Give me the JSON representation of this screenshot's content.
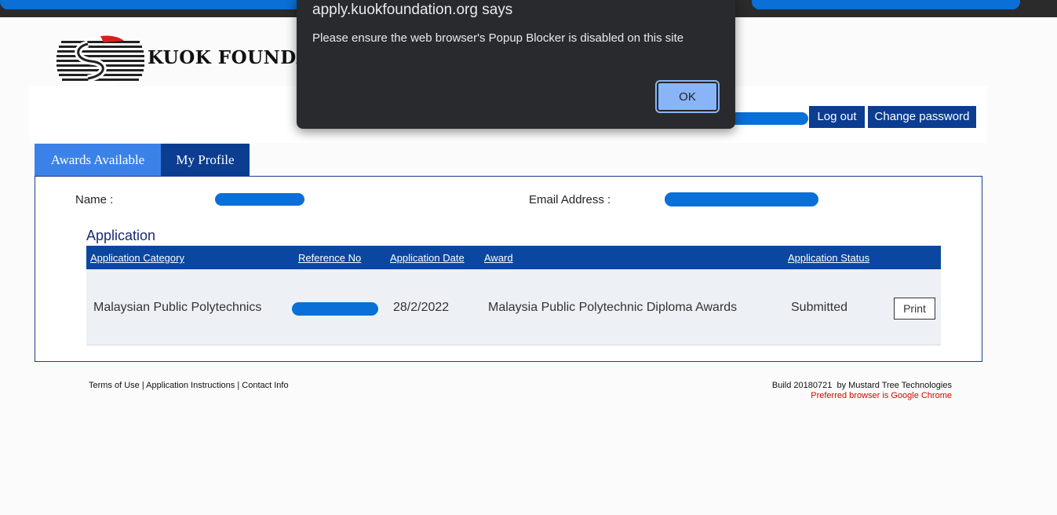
{
  "dialog": {
    "title": "apply.kuokfoundation.org says",
    "message": "Please ensure the web browser's Popup Blocker is disabled on this site",
    "ok_label": "OK"
  },
  "header": {
    "logo_text": "KUOK FOUNDAT",
    "logout_label": "Log out",
    "change_password_label": "Change password"
  },
  "tabs": [
    {
      "label": "Awards Available",
      "color": "#3b82e8"
    },
    {
      "label": "My Profile",
      "color": "#0b3d91"
    }
  ],
  "profile": {
    "name_label": "Name :",
    "email_label": "Email Address :"
  },
  "application": {
    "title": "Application",
    "columns": [
      "Application Category",
      "Reference No",
      "Application Date",
      "Award",
      "Application Status"
    ],
    "rows": [
      {
        "category": "Malaysian Public Polytechnics",
        "date": "28/2/2022",
        "award": "Malaysia Public Polytechnic Diploma Awards",
        "status": "Submitted",
        "print_label": "Print"
      }
    ]
  },
  "footer": {
    "links": [
      "Terms of Use",
      "Application Instructions",
      "Contact Info"
    ],
    "separator": "|",
    "build": "Build 20180721  by Mustard Tree Technologies",
    "preferred": "Preferred browser is Google Chrome"
  },
  "colors": {
    "accent": "#0b3d91",
    "redaction": "#0a6fd6",
    "dialog_bg": "#292a2d"
  }
}
